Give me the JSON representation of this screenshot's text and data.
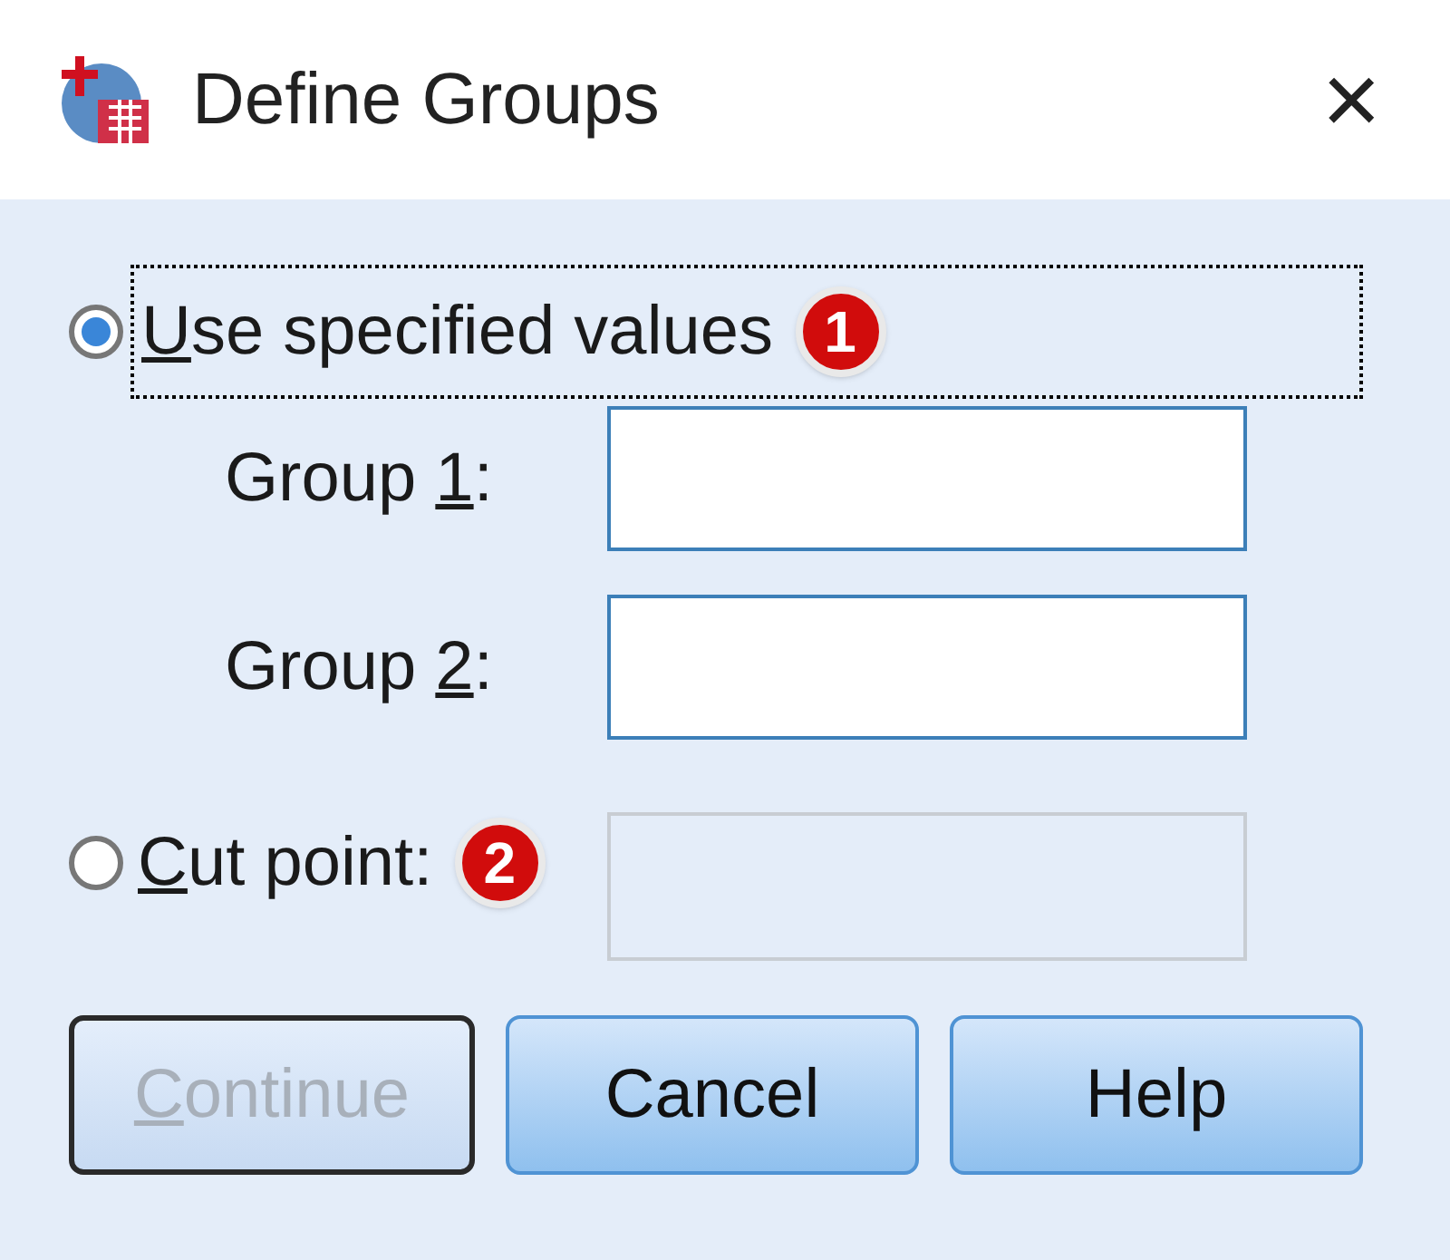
{
  "window": {
    "title": "Define Groups",
    "close": "×"
  },
  "options": [
    {
      "selected": true,
      "focused": true,
      "label": {
        "key": "U",
        "post": "se specified values"
      },
      "badge": "1"
    },
    {
      "selected": false,
      "focused": false,
      "label": {
        "key": "C",
        "post": "ut point:"
      },
      "badge": "2"
    }
  ],
  "groups": [
    {
      "label": {
        "pre": "Group ",
        "key": "1",
        "post": ":"
      }
    },
    {
      "label": {
        "pre": "Group ",
        "key": "2",
        "post": ":"
      }
    }
  ],
  "cut_point": {
    "disabled": true
  },
  "buttons": [
    {
      "label": {
        "key": "C",
        "post": "ontinue"
      },
      "disabled": true
    },
    {
      "label": {
        "pre": "Cancel"
      },
      "disabled": false
    },
    {
      "label": {
        "pre": "Help"
      },
      "disabled": false
    }
  ]
}
